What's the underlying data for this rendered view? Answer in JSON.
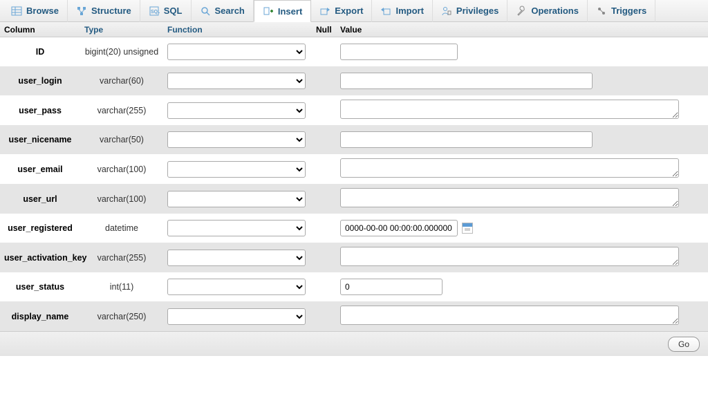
{
  "tabs": [
    {
      "label": "Browse"
    },
    {
      "label": "Structure"
    },
    {
      "label": "SQL"
    },
    {
      "label": "Search"
    },
    {
      "label": "Insert"
    },
    {
      "label": "Export"
    },
    {
      "label": "Import"
    },
    {
      "label": "Privileges"
    },
    {
      "label": "Operations"
    },
    {
      "label": "Triggers"
    }
  ],
  "headers": {
    "column": "Column",
    "type": "Type",
    "function": "Function",
    "null": "Null",
    "value": "Value"
  },
  "rows": [
    {
      "column": "ID",
      "type": "bigint(20) unsigned",
      "value": "",
      "input": "small"
    },
    {
      "column": "user_login",
      "type": "varchar(60)",
      "value": "",
      "input": "medium"
    },
    {
      "column": "user_pass",
      "type": "varchar(255)",
      "value": "",
      "input": "textarea"
    },
    {
      "column": "user_nicename",
      "type": "varchar(50)",
      "value": "",
      "input": "medium"
    },
    {
      "column": "user_email",
      "type": "varchar(100)",
      "value": "",
      "input": "textarea"
    },
    {
      "column": "user_url",
      "type": "varchar(100)",
      "value": "",
      "input": "textarea"
    },
    {
      "column": "user_registered",
      "type": "datetime",
      "value": "0000-00-00 00:00:00.000000",
      "input": "date"
    },
    {
      "column": "user_activation_key",
      "type": "varchar(255)",
      "value": "",
      "input": "textarea"
    },
    {
      "column": "user_status",
      "type": "int(11)",
      "value": "0",
      "input": "short"
    },
    {
      "column": "display_name",
      "type": "varchar(250)",
      "value": "",
      "input": "textarea"
    }
  ],
  "footer": {
    "go": "Go"
  }
}
